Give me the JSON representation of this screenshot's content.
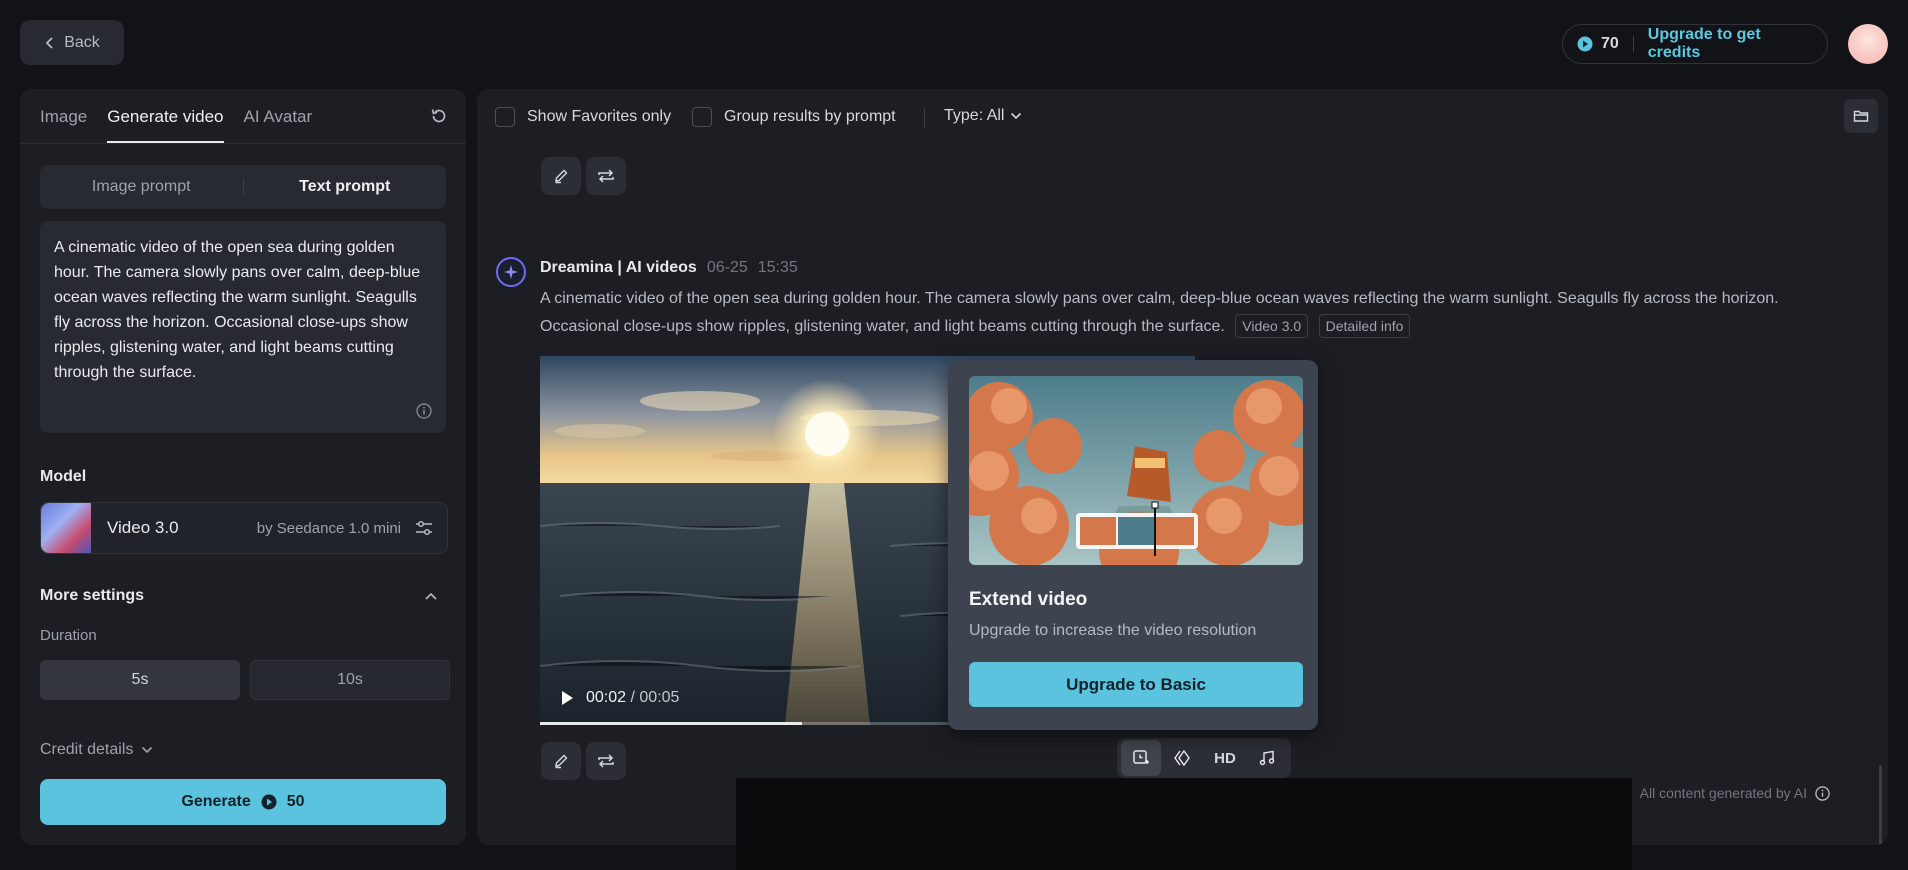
{
  "topbar": {
    "back_label": "Back",
    "credits": "70",
    "upgrade_label": "Upgrade to get credits"
  },
  "left": {
    "tabs": [
      "Image",
      "Generate video",
      "AI Avatar"
    ],
    "prompt_toggle": [
      "Image prompt",
      "Text prompt"
    ],
    "prompt_text": "A cinematic video of the open sea during golden hour. The camera slowly pans over calm, deep-blue ocean waves reflecting the warm sunlight. Seagulls fly across the horizon. Occasional close-ups show ripples, glistening water, and light beams cutting through the surface.",
    "model_label": "Model",
    "model_name": "Video 3.0",
    "model_by": "by Seedance 1.0 mini",
    "more_settings": "More settings",
    "duration_label": "Duration",
    "durations": [
      "5s",
      "10s"
    ],
    "credit_details": "Credit details",
    "generate_label": "Generate",
    "generate_cost": "50"
  },
  "right": {
    "show_favorites": "Show Favorites only",
    "group_results": "Group results by prompt",
    "type_filter": "Type: All",
    "result": {
      "source": "Dreamina | AI videos",
      "date": "06-25",
      "time": "15:35",
      "prompt": "A cinematic video of the open sea during golden hour. The camera slowly pans over calm, deep-blue ocean waves reflecting the warm sunlight. Seagulls fly across the horizon. Occasional close-ups show ripples, glistening water, and light beams cutting through the surface.",
      "chip_model": "Video 3.0",
      "chip_info": "Detailed info",
      "current_time": "00:02",
      "total_time": "00:05",
      "progress": 0.4,
      "hd_label": "HD"
    },
    "footer": "All content generated by AI"
  },
  "popup": {
    "title": "Extend video",
    "subtitle": "Upgrade to increase the video resolution",
    "button": "Upgrade to Basic"
  },
  "colors": {
    "accent": "#5bc3dd",
    "background": "#121317",
    "panel": "#1c1e24"
  }
}
